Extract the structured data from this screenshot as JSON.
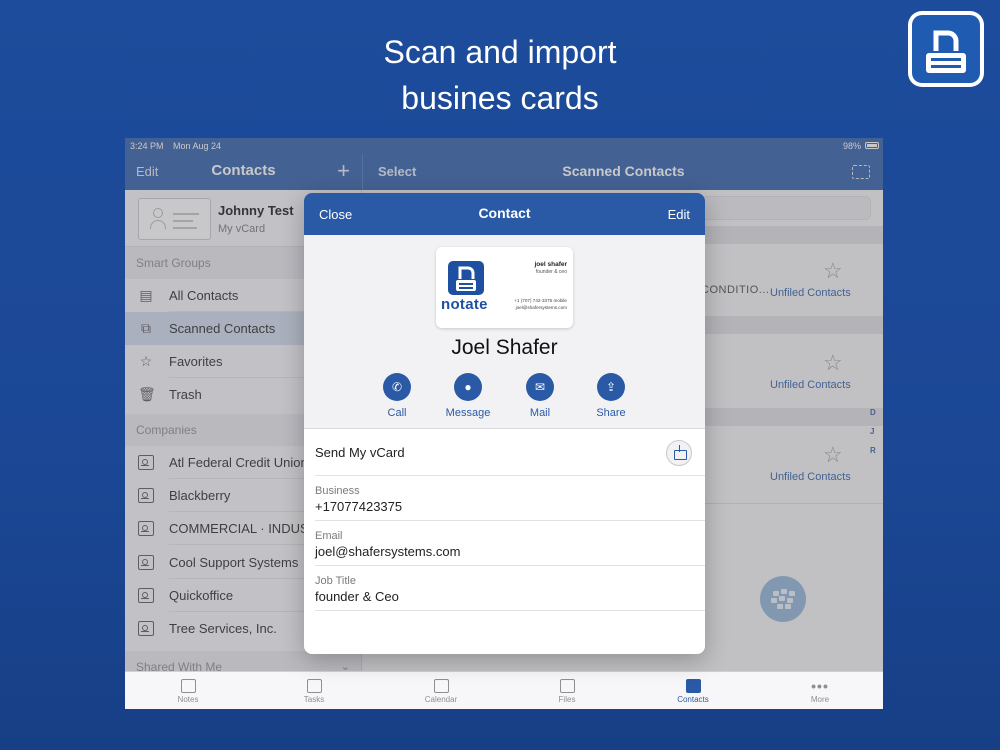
{
  "promo": {
    "line1": "Scan and import",
    "line2": "busines cards"
  },
  "status": {
    "time": "3:24 PM",
    "date": "Mon Aug 24",
    "battery": "98%"
  },
  "sidebar_nav": {
    "edit": "Edit",
    "title": "Contacts",
    "add": "+"
  },
  "list_nav": {
    "select": "Select",
    "title": "Scanned Contacts"
  },
  "my_card": {
    "name": "Johnny Test",
    "subtitle": "My vCard"
  },
  "smart_groups": {
    "header": "Smart Groups",
    "items": [
      {
        "label": "All Contacts",
        "icon": "all-contacts-icon"
      },
      {
        "label": "Scanned Contacts",
        "icon": "scan-icon",
        "selected": true
      },
      {
        "label": "Favorites",
        "icon": "star-icon"
      },
      {
        "label": "Trash",
        "icon": "trash-icon"
      }
    ]
  },
  "companies": {
    "header": "Companies",
    "items": [
      {
        "label": "Atl Federal Credit Union"
      },
      {
        "label": "Blackberry"
      },
      {
        "label": "COMMERCIAL · INDUSTRIAL"
      },
      {
        "label": "Cool Support Systems"
      },
      {
        "label": "Quickoffice"
      },
      {
        "label": "Tree Services, Inc."
      }
    ]
  },
  "shared": {
    "header": "Shared With Me"
  },
  "list_rows": [
    {
      "partial": "CONDITIO...",
      "group": "Unfiled Contacts"
    },
    {
      "partial": "",
      "group": "Unfiled Contacts"
    },
    {
      "partial": "",
      "group": "Unfiled Contacts"
    }
  ],
  "index_letters": [
    "D",
    "J",
    "R"
  ],
  "tabs": [
    {
      "label": "Notes",
      "active": false
    },
    {
      "label": "Tasks",
      "active": false
    },
    {
      "label": "Calendar",
      "active": false
    },
    {
      "label": "Files",
      "active": false
    },
    {
      "label": "Contacts",
      "active": true
    },
    {
      "label": "More",
      "active": false
    }
  ],
  "modal": {
    "close": "Close",
    "title": "Contact",
    "edit": "Edit",
    "card": {
      "brand": "notate",
      "name": "joel shafer",
      "role": "founder & ceo",
      "phone": "+1 (707) 742-3375  mobile",
      "email": "joel@shafersystems.com"
    },
    "contact_name": "Joel Shafer",
    "actions": [
      {
        "label": "Call",
        "icon": "phone-icon"
      },
      {
        "label": "Message",
        "icon": "message-icon"
      },
      {
        "label": "Mail",
        "icon": "mail-icon"
      },
      {
        "label": "Share",
        "icon": "share-icon"
      }
    ],
    "send_vcard": "Send My vCard",
    "fields": [
      {
        "label": "Business",
        "value": "+17077423375"
      },
      {
        "label": "Email",
        "value": "joel@shafersystems.com"
      },
      {
        "label": "Job Title",
        "value": "founder & Ceo"
      }
    ]
  },
  "colors": {
    "background": "#1d4c9c",
    "accent": "#2a5aa6",
    "selection": "#cfd9ea"
  }
}
